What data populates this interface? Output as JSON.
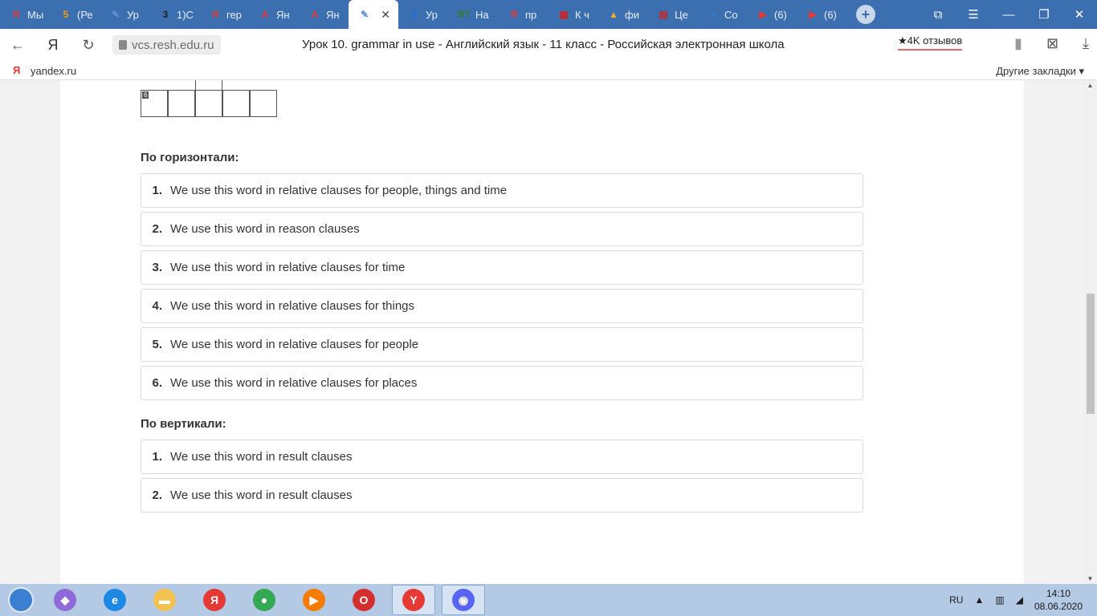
{
  "tabs": [
    {
      "title": "Мы",
      "icon": "yandex-icon",
      "color": "#e53935",
      "glyph": "Я"
    },
    {
      "title": "(Ре",
      "icon": "five-icon",
      "color": "#f59b00",
      "glyph": "5"
    },
    {
      "title": "Ур",
      "icon": "resh-icon",
      "color": "#5b8fd8",
      "glyph": "✎"
    },
    {
      "title": "1)С",
      "icon": "three-icon",
      "color": "#222222",
      "glyph": "3"
    },
    {
      "title": "гер",
      "icon": "yandex-icon",
      "color": "#e53935",
      "glyph": "Я"
    },
    {
      "title": "Ян",
      "icon": "translate-icon",
      "color": "#e53935",
      "glyph": "A"
    },
    {
      "title": "Ян",
      "icon": "translate-icon",
      "color": "#e53935",
      "glyph": "A"
    },
    {
      "title": "",
      "icon": "resh-icon",
      "color": "#5b8fd8",
      "glyph": "✎",
      "active": true
    },
    {
      "title": "Ур",
      "icon": "book-icon",
      "color": "#2a6fd0",
      "glyph": "▮"
    },
    {
      "title": "На",
      "icon": "rt-icon",
      "color": "#2e7d32",
      "glyph": "RT"
    },
    {
      "title": "пр",
      "icon": "yandex-icon",
      "color": "#e53935",
      "glyph": "Я"
    },
    {
      "title": "К ч",
      "icon": "calendar-icon",
      "color": "#c62828",
      "glyph": "▦"
    },
    {
      "title": "фи",
      "icon": "image-icon",
      "color": "#f9a825",
      "glyph": "▲"
    },
    {
      "title": "Це",
      "icon": "calculator-icon",
      "color": "#c62828",
      "glyph": "▤"
    },
    {
      "title": "Со",
      "icon": "chat-icon",
      "color": "#1e88e5",
      "glyph": "▪"
    },
    {
      "title": "(6)",
      "icon": "youtube-icon",
      "color": "#e53935",
      "glyph": "▶"
    },
    {
      "title": "(6)",
      "icon": "youtube-icon",
      "color": "#e53935",
      "glyph": "▶"
    }
  ],
  "browser": {
    "url": "vcs.resh.edu.ru",
    "page_title": "Урок 10. grammar in use - Английский язык - 11 класс - Российская электронная школа",
    "reviews": "★4K отзывов"
  },
  "bookmarks": {
    "ya_glyph": "Я",
    "link": "yandex.ru",
    "other": "Другие закладки ▾"
  },
  "crossword": {
    "cell_number": "6"
  },
  "across": {
    "title": "По горизонтали:",
    "clues": [
      {
        "num": "1.",
        "text": "We use this word in relative clauses for people, things and time"
      },
      {
        "num": "2.",
        "text": "We use this word in reason clauses"
      },
      {
        "num": "3.",
        "text": "We use this word in relative clauses for time"
      },
      {
        "num": "4.",
        "text": "We use this word in relative clauses for things"
      },
      {
        "num": "5.",
        "text": "We use this word in relative clauses for people"
      },
      {
        "num": "6.",
        "text": "We use this word in relative clauses for places"
      }
    ]
  },
  "down": {
    "title": "По вертикали:",
    "clues": [
      {
        "num": "1.",
        "text": "We use this word in result clauses"
      },
      {
        "num": "2.",
        "text": "We use this word in result clauses"
      }
    ]
  },
  "taskbar": {
    "apps": [
      {
        "name": "hub-app",
        "color": "#8e6bd8",
        "glyph": "◆"
      },
      {
        "name": "internet-explorer",
        "color": "#1e88e5",
        "glyph": "e"
      },
      {
        "name": "file-explorer",
        "color": "#f2c14e",
        "glyph": "▬"
      },
      {
        "name": "yandex-app",
        "color": "#e53935",
        "glyph": "Я"
      },
      {
        "name": "chrome-app",
        "color": "#34a853",
        "glyph": "●"
      },
      {
        "name": "media-player",
        "color": "#f57c00",
        "glyph": "▶"
      },
      {
        "name": "opera-app",
        "color": "#d32f2f",
        "glyph": "O"
      },
      {
        "name": "yandex-browser",
        "color": "#e53935",
        "glyph": "Y",
        "open": true
      },
      {
        "name": "discord-app",
        "color": "#5865f2",
        "glyph": "◉",
        "open": true
      }
    ],
    "lang": "RU",
    "time": "14:10",
    "date": "08.06.2020"
  }
}
